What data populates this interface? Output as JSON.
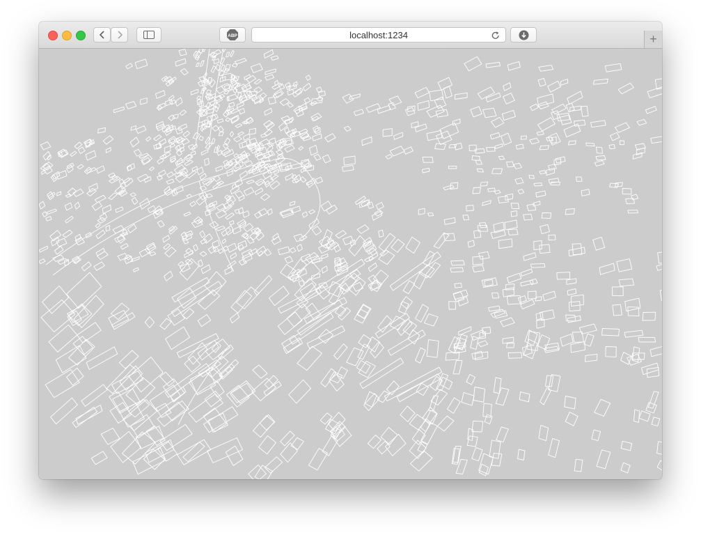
{
  "browser": {
    "url": "localhost:1234",
    "adblock_label": "ABP",
    "new_tab_label": "+",
    "colors": {
      "close": "#fc605b",
      "minimize": "#fdbc40",
      "zoom": "#34c84a",
      "map_background": "#cccccc",
      "building_outline": "#ffffff"
    }
  },
  "map": {
    "view": "perspective 3D building footprints"
  }
}
